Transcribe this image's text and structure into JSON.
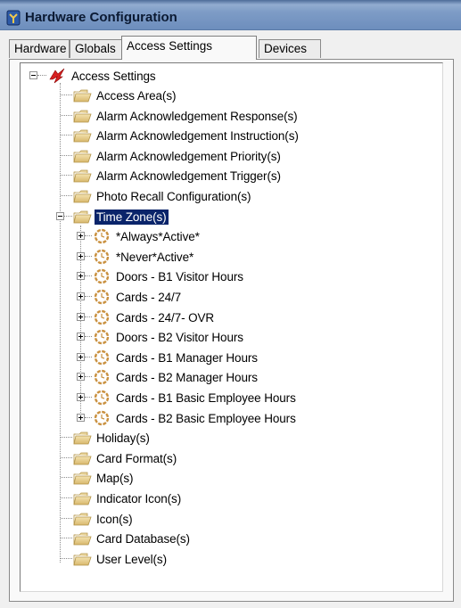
{
  "window": {
    "title": "Hardware Configuration",
    "title_icon": "hardware-config-icon"
  },
  "tabs": [
    {
      "label": "Hardware",
      "active": false
    },
    {
      "label": "Globals",
      "active": false
    },
    {
      "label": "Access Settings",
      "active": true
    },
    {
      "label": "Devices",
      "active": false
    }
  ],
  "tree": {
    "root": {
      "label": "Access Settings",
      "icon": "access-settings-icon",
      "expanded": true
    },
    "items_before": [
      {
        "label": "Access Area(s)",
        "icon": "folder-icon"
      },
      {
        "label": "Alarm Acknowledgement Response(s)",
        "icon": "folder-icon"
      },
      {
        "label": "Alarm Acknowledgement Instruction(s)",
        "icon": "folder-icon"
      },
      {
        "label": "Alarm Acknowledgement Priority(s)",
        "icon": "folder-icon"
      },
      {
        "label": "Alarm Acknowledgement Trigger(s)",
        "icon": "folder-icon"
      },
      {
        "label": "Photo Recall Configuration(s)",
        "icon": "folder-icon"
      }
    ],
    "time_zones": {
      "label": "Time Zone(s)",
      "icon": "folder-icon",
      "expanded": true,
      "selected": true,
      "children": [
        {
          "label": "*Always*Active*",
          "icon": "clock-icon"
        },
        {
          "label": "*Never*Active*",
          "icon": "clock-icon"
        },
        {
          "label": "Doors - B1 Visitor Hours",
          "icon": "clock-icon"
        },
        {
          "label": "Cards - 24/7",
          "icon": "clock-icon"
        },
        {
          "label": "Cards - 24/7- OVR",
          "icon": "clock-icon"
        },
        {
          "label": "Doors - B2 Visitor Hours",
          "icon": "clock-icon"
        },
        {
          "label": "Cards - B1 Manager Hours",
          "icon": "clock-icon"
        },
        {
          "label": "Cards - B2 Manager Hours",
          "icon": "clock-icon"
        },
        {
          "label": "Cards - B1 Basic Employee Hours",
          "icon": "clock-icon"
        },
        {
          "label": "Cards - B2 Basic Employee Hours",
          "icon": "clock-icon"
        }
      ]
    },
    "items_after": [
      {
        "label": "Holiday(s)",
        "icon": "folder-icon"
      },
      {
        "label": "Card Format(s)",
        "icon": "folder-icon"
      },
      {
        "label": "Map(s)",
        "icon": "folder-icon"
      },
      {
        "label": "Indicator Icon(s)",
        "icon": "folder-icon"
      },
      {
        "label": "Icon(s)",
        "icon": "folder-icon"
      },
      {
        "label": "Card Database(s)",
        "icon": "folder-icon"
      },
      {
        "label": "User Level(s)",
        "icon": "folder-icon"
      }
    ]
  }
}
